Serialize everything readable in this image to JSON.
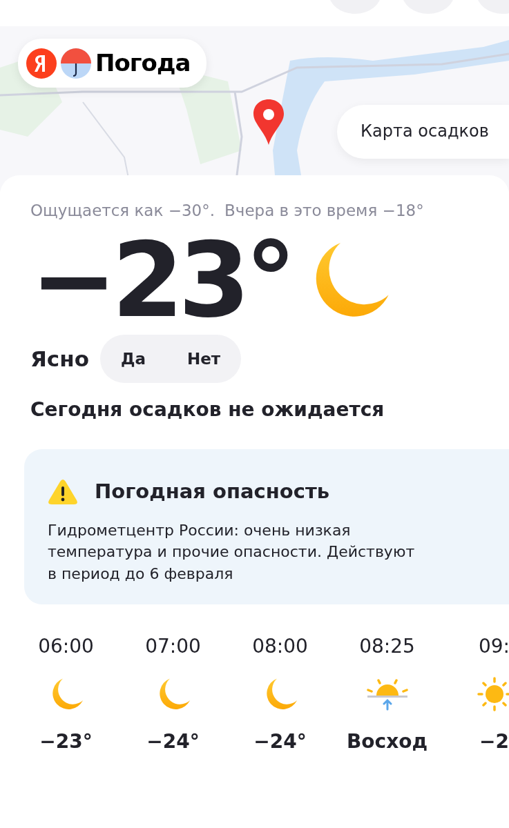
{
  "logo": {
    "text": "Погода"
  },
  "map": {
    "kind": "picture",
    "button": "Карта осадков"
  },
  "current": {
    "feels_like": "Ощущается как −30°.",
    "yesterday": "Вчера в это время −18°",
    "temperature": "−23°",
    "condition": "Ясно",
    "condition_icon": {
      "kind": "moon"
    },
    "feedback": [
      "Да",
      "Нет"
    ],
    "precipitation": "Сегодня осадков не ожидается"
  },
  "alert": {
    "title": "Погодная опасность",
    "text": "Гидрометцентр России: очень низкая температура и прочие опасности. Действуют в период до 6 февраля"
  },
  "hourly": [
    {
      "time": "06:00",
      "kind": "moon",
      "value": "−23°"
    },
    {
      "time": "07:00",
      "kind": "moon",
      "value": "−24°"
    },
    {
      "time": "08:00",
      "kind": "moon",
      "value": "−24°"
    },
    {
      "time": "08:25",
      "kind": "sunrise",
      "value": "Восход"
    },
    {
      "time": "09:",
      "kind": "sun",
      "value": "−2"
    }
  ]
}
